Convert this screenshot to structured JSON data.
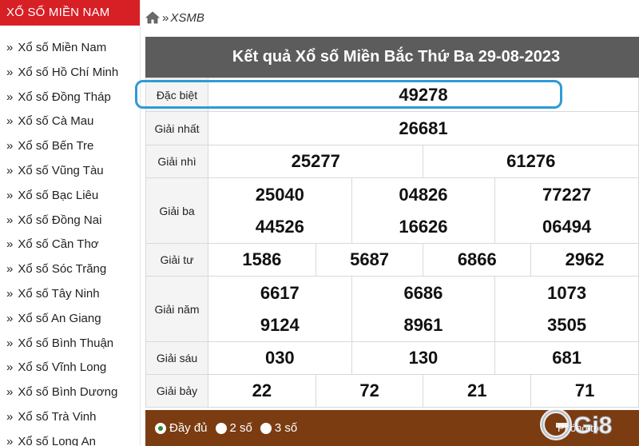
{
  "sidebar": {
    "header": "XỔ SỐ MIỀN NAM",
    "items": [
      "Xổ số Miền Nam",
      "Xổ số Hồ Chí Minh",
      "Xổ số Đồng Tháp",
      "Xổ số Cà Mau",
      "Xổ số Bến Tre",
      "Xổ số Vũng Tàu",
      "Xổ số Bạc Liêu",
      "Xổ số Đồng Nai",
      "Xổ số Cần Thơ",
      "Xổ số Sóc Trăng",
      "Xổ số Tây Ninh",
      "Xổ số An Giang",
      "Xổ số Bình Thuận",
      "Xổ số Vĩnh Long",
      "Xổ số Bình Dương",
      "Xổ số Trà Vinh",
      "Xổ số Long An"
    ]
  },
  "breadcrumb": {
    "separator": "»",
    "current": "XSMB"
  },
  "results": {
    "title": "Kết quả Xổ số Miền Bắc Thứ Ba 29-08-2023",
    "special": {
      "label": "Đặc biệt",
      "number": "49278"
    },
    "first": {
      "label": "Giải nhất",
      "number": "26681"
    },
    "second": {
      "label": "Giải nhì",
      "numbers": [
        "25277",
        "61276"
      ]
    },
    "third": {
      "label": "Giải ba",
      "numbers": [
        "25040",
        "04826",
        "77227",
        "44526",
        "16626",
        "06494"
      ]
    },
    "fourth": {
      "label": "Giải tư",
      "numbers": [
        "1586",
        "5687",
        "6866",
        "2962"
      ]
    },
    "fifth": {
      "label": "Giải năm",
      "numbers": [
        "6617",
        "6686",
        "1073",
        "9124",
        "8961",
        "3505"
      ]
    },
    "sixth": {
      "label": "Giải sáu",
      "numbers": [
        "030",
        "130",
        "681"
      ]
    },
    "seventh": {
      "label": "Giải bảy",
      "numbers": [
        "22",
        "72",
        "21",
        "71"
      ]
    }
  },
  "footer": {
    "options": [
      "Đầy đủ",
      "2 số",
      "3 số"
    ],
    "selected": "Đầy đủ",
    "zoom_label": "Phóng to"
  },
  "colors": {
    "sidebar_header": "#d71f26",
    "title_bar": "#5c5c5c",
    "special_number": "#c0392b",
    "footer_bar": "#7b3c12",
    "highlight": "#2e9bd6"
  },
  "watermark": {
    "text": "Gi8"
  }
}
